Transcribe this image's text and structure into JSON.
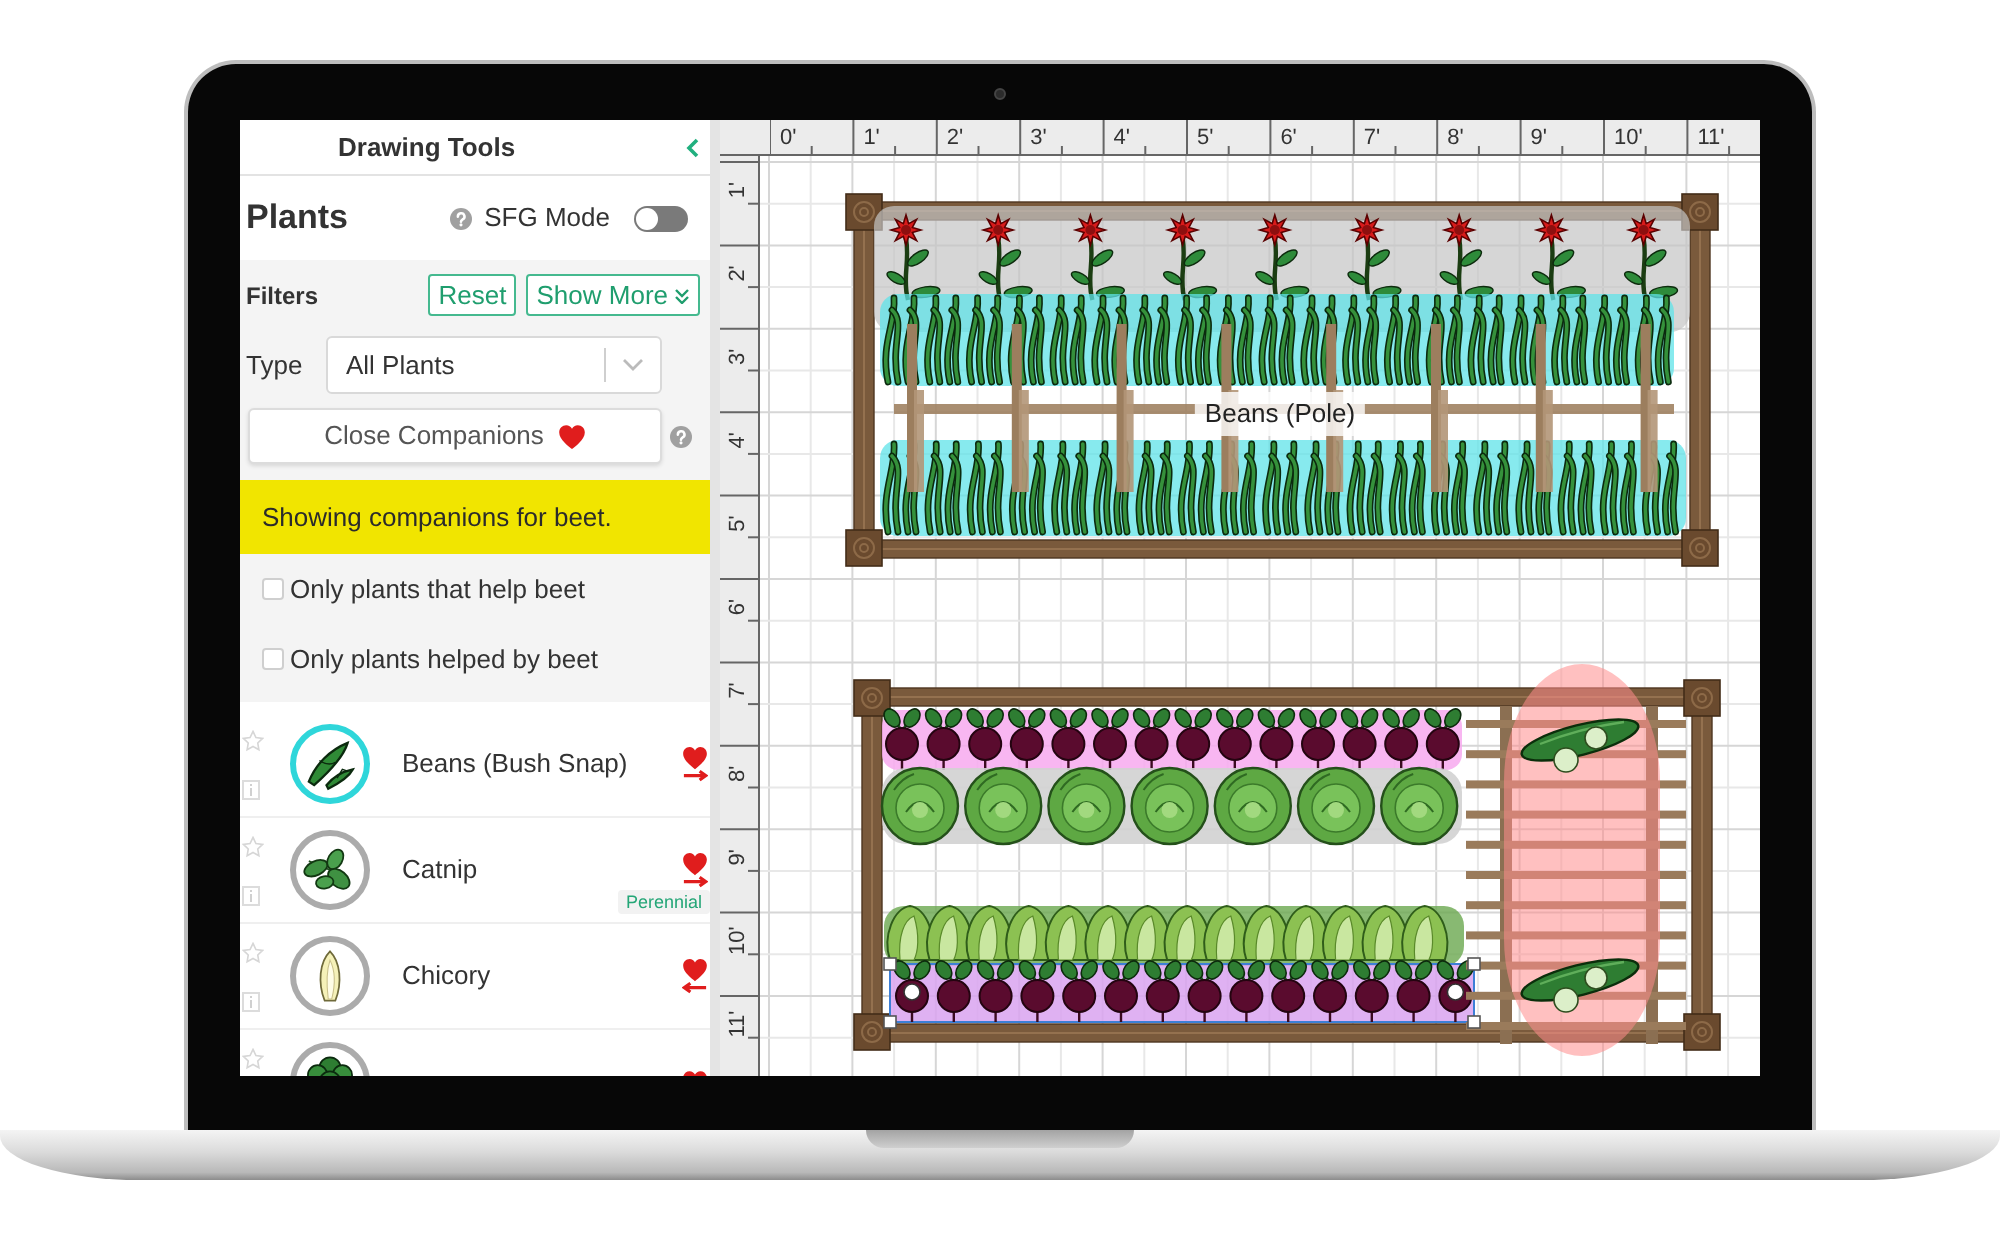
{
  "sidebar": {
    "title": "Drawing Tools",
    "section": "Plants",
    "sfg_mode": {
      "label": "SFG Mode",
      "on": false
    },
    "filters": {
      "label": "Filters",
      "reset_button": "Reset",
      "more_button": "Show More",
      "type": {
        "label": "Type",
        "value": "All Plants"
      },
      "companions_button": "Close Companions",
      "notice": "Showing companions for beet.",
      "options": [
        {
          "label": "Only plants that help beet",
          "checked": false
        },
        {
          "label": "Only plants helped by beet",
          "checked": false
        }
      ]
    },
    "plants": [
      {
        "kind": "beans",
        "name": "Beans (Bush Snap)",
        "selected": true,
        "arrow_right": true
      },
      {
        "kind": "catnip",
        "name": "Catnip",
        "selected": false,
        "arrow_right": true,
        "tag": "Perennial"
      },
      {
        "kind": "chicory",
        "name": "Chicory",
        "selected": false,
        "arrow_right": false
      },
      {
        "kind": "leafy",
        "selected": false
      }
    ]
  },
  "canvas": {
    "ruler_x": [
      "0'",
      "1'",
      "2'",
      "3'",
      "4'",
      "5'",
      "6'",
      "7'",
      "8'",
      "9'",
      "10'",
      "11'"
    ],
    "ruler_y": [
      "1'",
      "2'",
      "3'",
      "4'",
      "5'",
      "6'",
      "7'",
      "8'",
      "9'",
      "10'",
      "11'"
    ],
    "beds": [
      {
        "label": "Beans (Pole)",
        "items": [
          {
            "kind": "bee_balm",
            "selected": false
          },
          {
            "kind": "pole_beans",
            "selected": false
          },
          {
            "kind": "pole_beans",
            "selected": false
          },
          {
            "kind": "trellis",
            "selected": false
          }
        ]
      },
      {
        "items": [
          {
            "kind": "beet",
            "selected": false
          },
          {
            "kind": "cabbage",
            "selected": false
          },
          {
            "kind": "lettuce",
            "selected": false
          },
          {
            "kind": "beet",
            "selected": true
          },
          {
            "kind": "trellis",
            "selected": false
          },
          {
            "kind": "cucumber",
            "selected": false
          }
        ]
      }
    ]
  }
}
